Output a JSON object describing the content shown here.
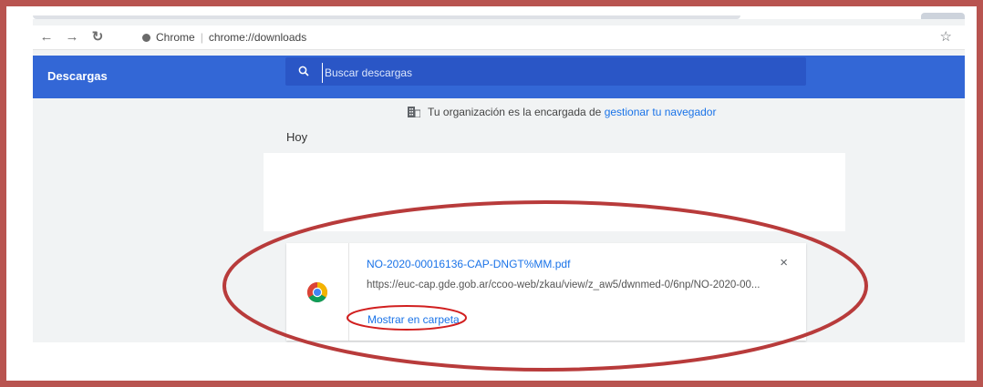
{
  "browser": {
    "address": {
      "site": "Chrome",
      "url": "chrome://downloads"
    },
    "nav_icons": [
      "back-arrow-icon",
      "forward-arrow-icon",
      "reload-icon"
    ],
    "bookmark_icon": "star-icon"
  },
  "page": {
    "title": "Descargas",
    "search": {
      "placeholder": "Buscar descargas",
      "icon": "search-icon"
    },
    "managed_notice": {
      "text": "Tu organización es la encargada de",
      "link": "gestionar tu navegador"
    },
    "date_header": "Hoy",
    "downloads": [
      {
        "file_name": "NO-2020-00016136-CAP-DNGT%MM.pdf",
        "url": "https://euc-cap.gde.gob.ar/ccoo-web/zkau/view/z_aw5/dwnmed-0/6np/NO-2020-00...",
        "action": "Mostrar en carpeta",
        "remove_symbol": "×",
        "icon": "chrome-icon"
      }
    ]
  },
  "colors": {
    "header": "#3367d6",
    "search_bg": "#2a56c6",
    "link": "#1a73e8",
    "annotation": "#b83b3b",
    "frame": "#b85450"
  }
}
